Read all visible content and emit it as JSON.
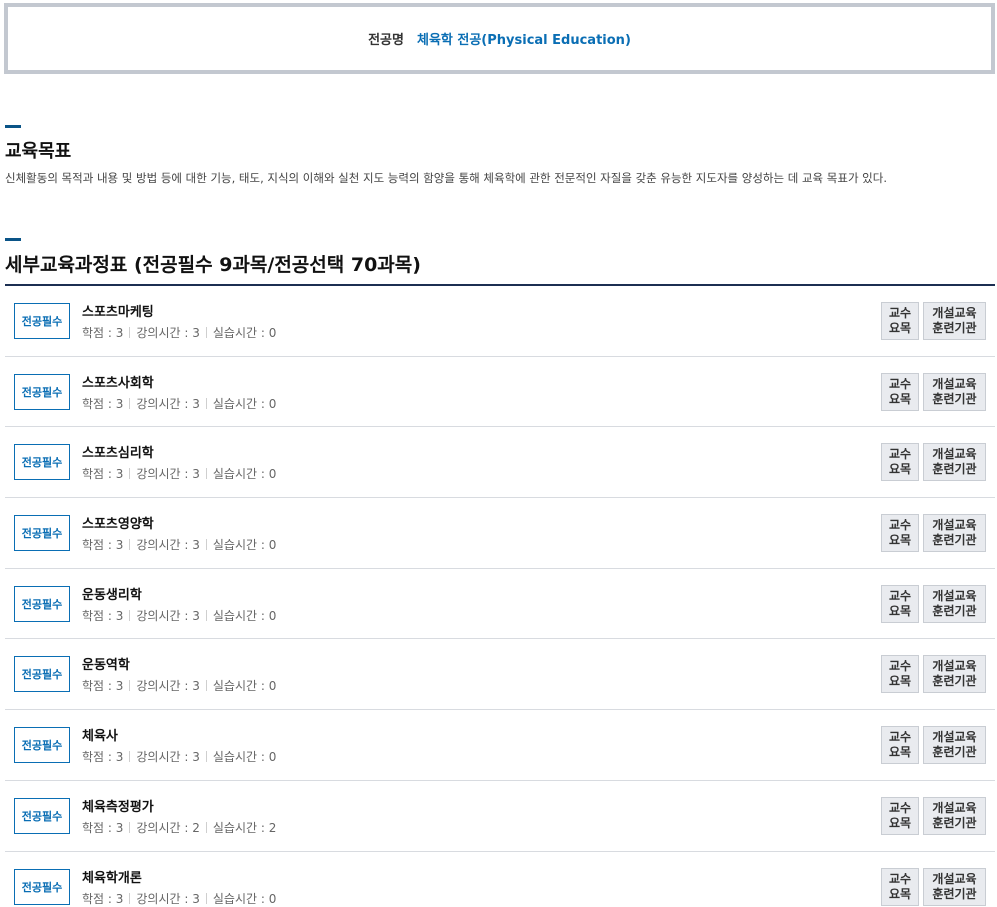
{
  "major": {
    "label": "전공명",
    "value": "체육학 전공(Physical Education)"
  },
  "goal": {
    "title": "교육목표",
    "text": "신체활동의 목적과 내용 및 방법 등에 대한 기능, 태도, 지식의 이해와 실천 지도 능력의 함양을 통해 체육학에 관한 전문적인 자질을 갖춘 유능한 지도자를 양성하는 데 교육 목표가 있다."
  },
  "curriculum": {
    "title": "세부교육과정표 (전공필수 9과목/전공선택 70과목)",
    "button_prof_line1": "교수",
    "button_prof_line2": "요목",
    "button_inst_line1": "개설교육",
    "button_inst_line2": "훈련기관",
    "courses": [
      {
        "badge": "전공필수",
        "name": "스포츠마케팅",
        "credit": "학점 : 3",
        "lecture": "강의시간 : 3",
        "practice": "실습시간 : 0"
      },
      {
        "badge": "전공필수",
        "name": "스포츠사회학",
        "credit": "학점 : 3",
        "lecture": "강의시간 : 3",
        "practice": "실습시간 : 0"
      },
      {
        "badge": "전공필수",
        "name": "스포츠심리학",
        "credit": "학점 : 3",
        "lecture": "강의시간 : 3",
        "practice": "실습시간 : 0"
      },
      {
        "badge": "전공필수",
        "name": "스포츠영양학",
        "credit": "학점 : 3",
        "lecture": "강의시간 : 3",
        "practice": "실습시간 : 0"
      },
      {
        "badge": "전공필수",
        "name": "운동생리학",
        "credit": "학점 : 3",
        "lecture": "강의시간 : 3",
        "practice": "실습시간 : 0"
      },
      {
        "badge": "전공필수",
        "name": "운동역학",
        "credit": "학점 : 3",
        "lecture": "강의시간 : 3",
        "practice": "실습시간 : 0"
      },
      {
        "badge": "전공필수",
        "name": "체육사",
        "credit": "학점 : 3",
        "lecture": "강의시간 : 3",
        "practice": "실습시간 : 0"
      },
      {
        "badge": "전공필수",
        "name": "체육측정평가",
        "credit": "학점 : 3",
        "lecture": "강의시간 : 2",
        "practice": "실습시간 : 2"
      },
      {
        "badge": "전공필수",
        "name": "체육학개론",
        "credit": "학점 : 3",
        "lecture": "강의시간 : 3",
        "practice": "실습시간 : 0"
      }
    ]
  }
}
